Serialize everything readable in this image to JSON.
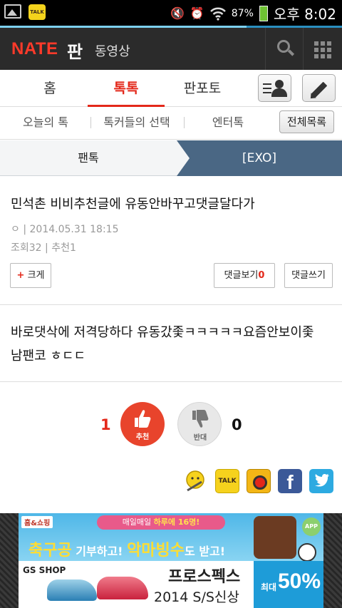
{
  "status_bar": {
    "talk_label": "TALK",
    "wifi_icon": "wifi-icon",
    "battery_percent": "87%",
    "time": "오후 8:02",
    "battery_color": "#6ec233"
  },
  "page_load_progress": 0.72,
  "header": {
    "logo": "NATE",
    "section": "판",
    "video_link": "동영상",
    "search_icon": "search-icon",
    "menu_icon": "grid-menu-icon",
    "accent": "#ff3a2a"
  },
  "tabs": {
    "items": [
      {
        "label": "홈",
        "active": false
      },
      {
        "label": "톡톡",
        "active": true
      },
      {
        "label": "판포토",
        "active": false
      }
    ],
    "profile_icon": "my-profile-icon",
    "write_icon": "pencil-icon",
    "active_color": "#e3281a"
  },
  "subtabs": {
    "items": [
      "오늘의 톡",
      "톡커들의 선택",
      "엔터톡"
    ],
    "all_list": "전체목록"
  },
  "category": {
    "parent": "팬톡",
    "current": "[EXO]",
    "current_bg": "#4a6784"
  },
  "article": {
    "title": "민석촌 비비추천글에 유동안바꾸고댓글달다가",
    "author": "ㅇ",
    "datetime": "2014.05.31 18:15",
    "views_label": "조회32",
    "recommend_label": "추천1",
    "enlarge_label": "크게",
    "comments_view_label": "댓글보기",
    "comments_count": "0",
    "comment_write_label": "댓글쓰기",
    "body_line1": "바로댓삭에 저격당하다 유동갔좇ㅋㅋㅋㅋㅋ요즘안보이좇",
    "body_line2": "남팬코 ㅎㄷㄷ"
  },
  "votes": {
    "up_count": "1",
    "up_label": "추천",
    "down_count": "0",
    "down_label": "반대",
    "up_color": "#e8442c"
  },
  "share": {
    "items": [
      {
        "name": "me2day-icon"
      },
      {
        "name": "kakaotalk-icon",
        "label": "TALK"
      },
      {
        "name": "kakaostory-icon"
      },
      {
        "name": "facebook-icon",
        "label": "f"
      },
      {
        "name": "twitter-icon"
      }
    ]
  },
  "ad": {
    "top_logo": "홈&쇼핑",
    "top_banner_a": "매일매일",
    "top_banner_b": "하루에 16명!",
    "top_main_a": "축구공",
    "top_main_b": " 기부하고! ",
    "top_main_c": "악마빙수",
    "top_main_d": "도 받고!",
    "app_label": "APP",
    "bottom_logo": "GS SHOP",
    "bottom_brand": "프로스펙스",
    "bottom_season": "2014 S/S신상",
    "bottom_sale_prefix": "최대",
    "bottom_sale_pct": "50%"
  }
}
